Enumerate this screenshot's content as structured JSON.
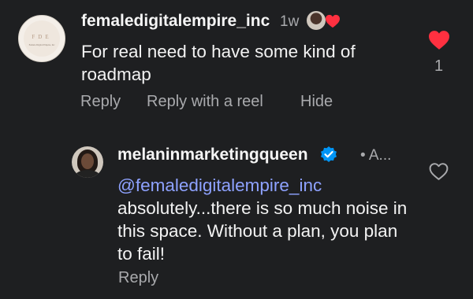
{
  "comment": {
    "username": "femaledigitalempire_inc",
    "time": "1w",
    "avatar_monogram": "FDE",
    "avatar_name": "Female Digital Empire, Inc",
    "text": "For real need to have some kind of roadmap",
    "actions": {
      "reply": "Reply",
      "reply_with_reel": "Reply with a reel",
      "hide": "Hide"
    },
    "like_count": "1",
    "liked": true
  },
  "reply": {
    "username": "melaninmarketingqueen",
    "verified": true,
    "time": "• A...",
    "mention": "@femaledigitalempire_inc",
    "text": "absolutely...there is so much noise in this space. Without a plan, you plan to fail!",
    "actions": {
      "reply": "Reply"
    },
    "liked": false
  },
  "colors": {
    "background": "#1e1f21",
    "like_red": "#ff3040",
    "mention": "#8ea2ff",
    "muted": "#a9aaad",
    "verified_blue": "#0095f6"
  }
}
